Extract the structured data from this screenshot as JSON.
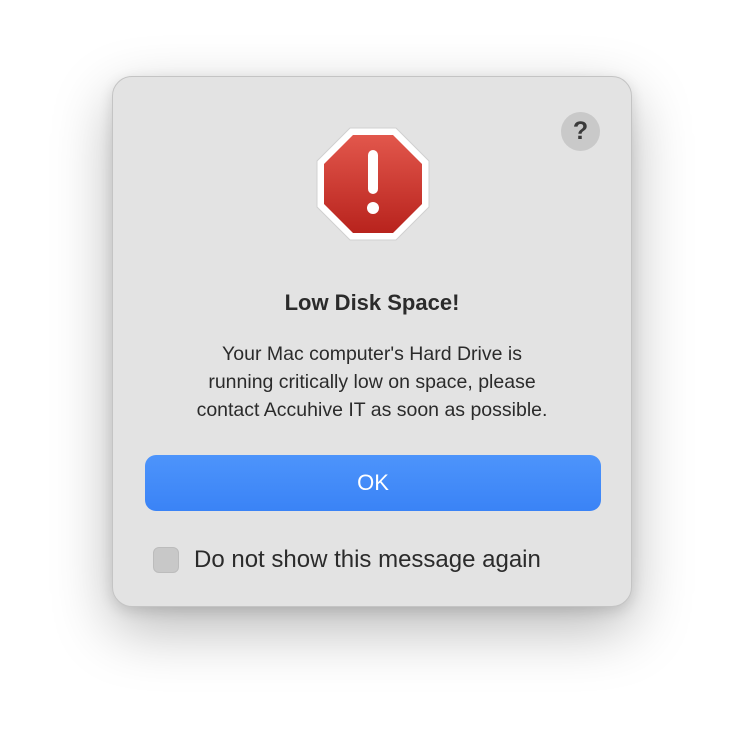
{
  "dialog": {
    "help_label": "?",
    "icon": "stop-alert-icon",
    "title": "Low Disk Space!",
    "message_lines": [
      "Your Mac computer's Hard Drive is",
      "running critically low on space, please",
      "contact Accuhive IT as soon as possible."
    ],
    "ok_label": "OK",
    "checkbox_label": "Do not show this message again",
    "checkbox_checked": false
  },
  "colors": {
    "dialog_bg": "#e3e3e3",
    "accent": "#3a83f6",
    "alert_red": "#cc3b30"
  }
}
